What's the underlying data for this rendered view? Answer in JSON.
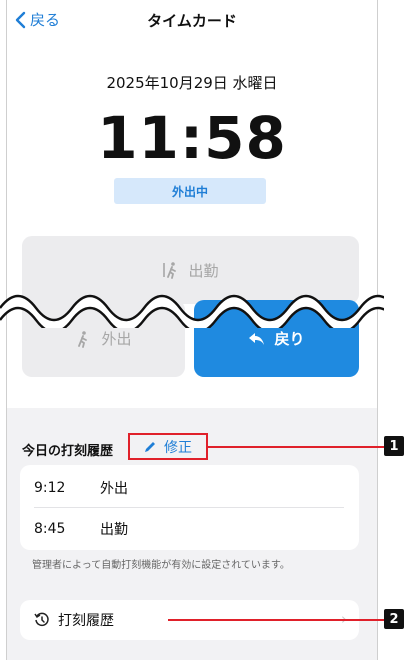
{
  "header": {
    "back_label": "戻る",
    "title": "タイムカード"
  },
  "clock": {
    "date": "2025年10月29日 水曜日",
    "time": "11:58",
    "status": "外出中"
  },
  "actions": {
    "clock_in": "出勤",
    "go_out": "外出",
    "return": "戻り"
  },
  "history": {
    "section_title": "今日の打刻履歴",
    "edit_label": "修正",
    "rows": [
      {
        "time": "9:12",
        "kind": "外出"
      },
      {
        "time": "8:45",
        "kind": "出勤"
      }
    ],
    "note": "管理者によって自動打刻機能が有効に設定されています。",
    "link_label": "打刻履歴"
  },
  "callouts": {
    "one": "1",
    "two": "2"
  },
  "colors": {
    "accent": "#1f8ae0",
    "callout": "#e0202a",
    "status_bg": "#d6e8fb"
  }
}
